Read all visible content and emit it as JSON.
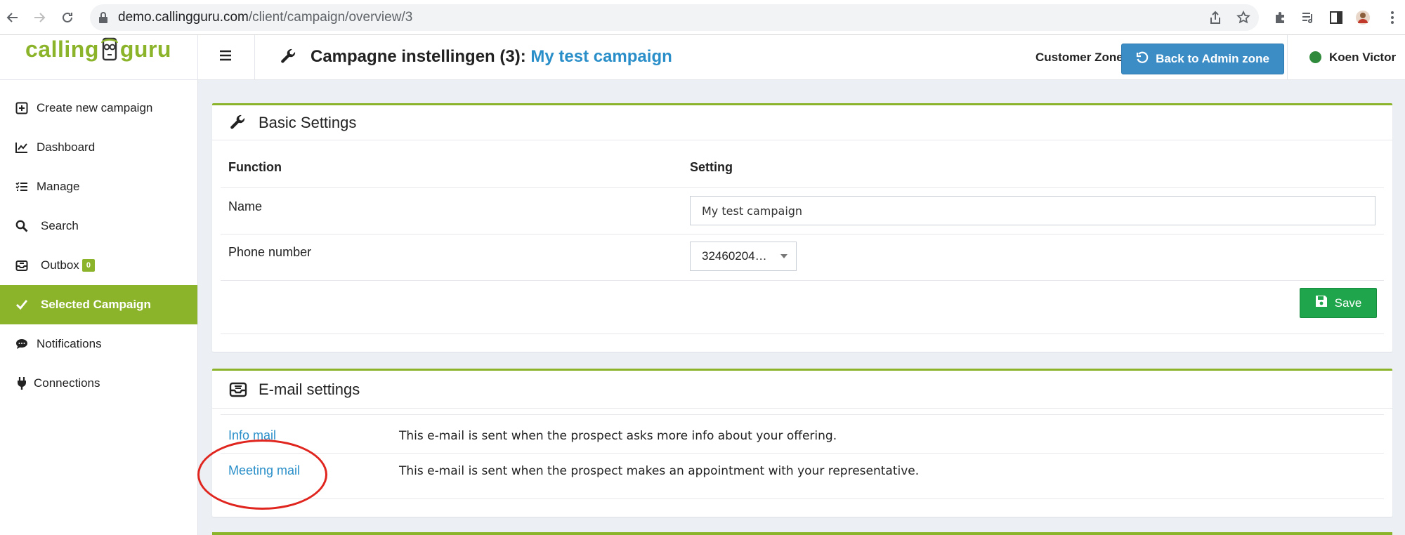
{
  "browser": {
    "url_host": "demo.callingguru.com",
    "url_path": "/client/campaign/overview/3"
  },
  "header": {
    "logo_left": "calling",
    "logo_right": "guru",
    "title_prefix": "Campagne instellingen (3):",
    "title_campaign": "My test campaign",
    "customer_zone": "Customer Zone",
    "admin_button": "Back to Admin zone",
    "user_name": "Koen Victor"
  },
  "sidebar": {
    "items": [
      {
        "label": "Create new campaign",
        "icon": "plus-square-icon"
      },
      {
        "label": "Dashboard",
        "icon": "line-chart-icon"
      },
      {
        "label": "Manage",
        "icon": "tasks-icon"
      },
      {
        "label": "Search",
        "icon": "search-icon"
      },
      {
        "label": "Outbox",
        "icon": "inbox-icon",
        "badge": "0"
      },
      {
        "label": "Selected Campaign",
        "icon": "check-icon",
        "active": true
      },
      {
        "label": "Notifications",
        "icon": "comments-icon"
      },
      {
        "label": "Connections",
        "icon": "plug-icon"
      }
    ]
  },
  "basic_settings": {
    "title": "Basic Settings",
    "col_function": "Function",
    "col_setting": "Setting",
    "rows": [
      {
        "label": "Name",
        "value": "My test campaign"
      },
      {
        "label": "Phone number",
        "value": "32460204…"
      }
    ],
    "save_label": "Save"
  },
  "email_settings": {
    "title": "E-mail settings",
    "rows": [
      {
        "link": "Info mail",
        "description": "This e-mail is sent when the prospect asks more info about your offering."
      },
      {
        "link": "Meeting mail",
        "description": "This e-mail is sent when the prospect makes an appointment with your representative."
      }
    ]
  },
  "colors": {
    "brand_green": "#8cb42a",
    "link_blue": "#2a8fc9",
    "admin_blue": "#3c8dc5",
    "save_green": "#1fa54b",
    "annotation_red": "#e0241e"
  }
}
